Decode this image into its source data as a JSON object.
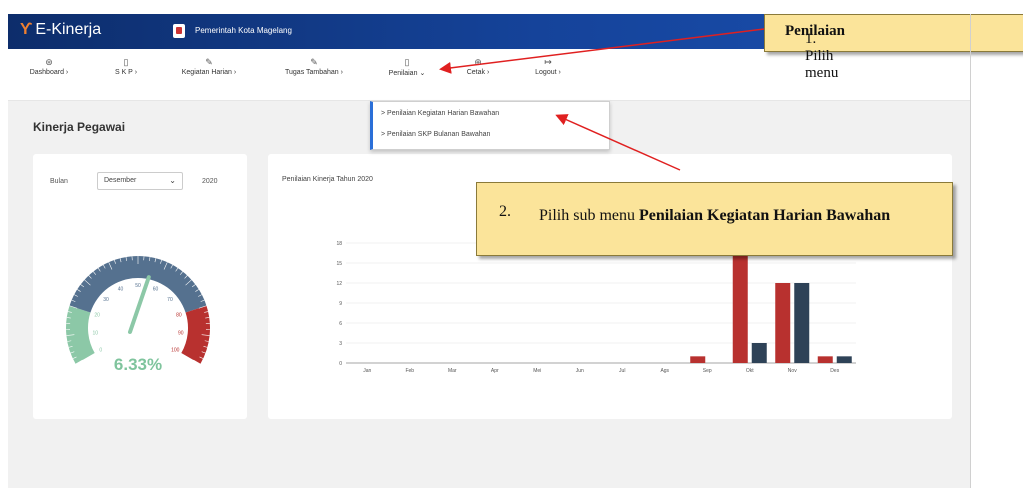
{
  "app": {
    "name": "E-Kinerja",
    "logo_mark": "ϒ",
    "government": "Pemerintah Kota Magelang"
  },
  "nav": [
    {
      "icon": "dashboard-icon",
      "glyph": "⊛",
      "label": "Dashboard"
    },
    {
      "icon": "document-icon",
      "glyph": "▯",
      "label": "S K P"
    },
    {
      "icon": "edit-icon",
      "glyph": "✎",
      "label": "Kegiatan Harian"
    },
    {
      "icon": "edit-icon",
      "glyph": "✎",
      "label": "Tugas Tambahan"
    },
    {
      "icon": "document-icon",
      "glyph": "▯",
      "label": "Penilaian"
    },
    {
      "icon": "print-icon",
      "glyph": "⊕",
      "label": "Cetak"
    },
    {
      "icon": "logout-icon",
      "glyph": "↦",
      "label": "Logout"
    }
  ],
  "dropdown": {
    "items": [
      "> Penilaian Kegiatan Harian Bawahan",
      "> Penilaian SKP Bulanan Bawahan"
    ]
  },
  "page_title": "Kinerja Pegawai",
  "filter": {
    "label": "Bulan",
    "selected": "Desember",
    "year": "2020"
  },
  "gauge": {
    "value_text": "6.33%",
    "value": 6.33,
    "tick_labels": [
      "0",
      "10",
      "20",
      "30",
      "40",
      "50",
      "60",
      "70",
      "80",
      "90",
      "100"
    ]
  },
  "chart_data": {
    "type": "bar",
    "title": "Penilaian Kinerja Tahun 2020",
    "categories": [
      "Jan",
      "Feb",
      "Mar",
      "Apr",
      "Mei",
      "Jun",
      "Jul",
      "Ags",
      "Sep",
      "Okt",
      "Nov",
      "Des"
    ],
    "series": [
      {
        "values": [
          0,
          0,
          0,
          0,
          0,
          0,
          0,
          0,
          1,
          18,
          12,
          1
        ]
      },
      {
        "values": [
          0,
          0,
          0,
          0,
          0,
          0,
          0,
          0,
          0,
          3,
          12,
          1
        ]
      }
    ],
    "colors": [
      "#b8312f",
      "#2e4257"
    ],
    "ylim": [
      0,
      18
    ],
    "yticks": [
      0,
      3,
      6,
      9,
      12,
      15,
      18
    ],
    "grid": true
  },
  "callouts": {
    "first": {
      "prefix": "1. Pilih menu ",
      "bold": "Penilaian"
    },
    "second": {
      "num": "2.",
      "prefix": "Pilih sub menu ",
      "bold": "Penilaian Kegiatan Harian Bawahan"
    }
  }
}
